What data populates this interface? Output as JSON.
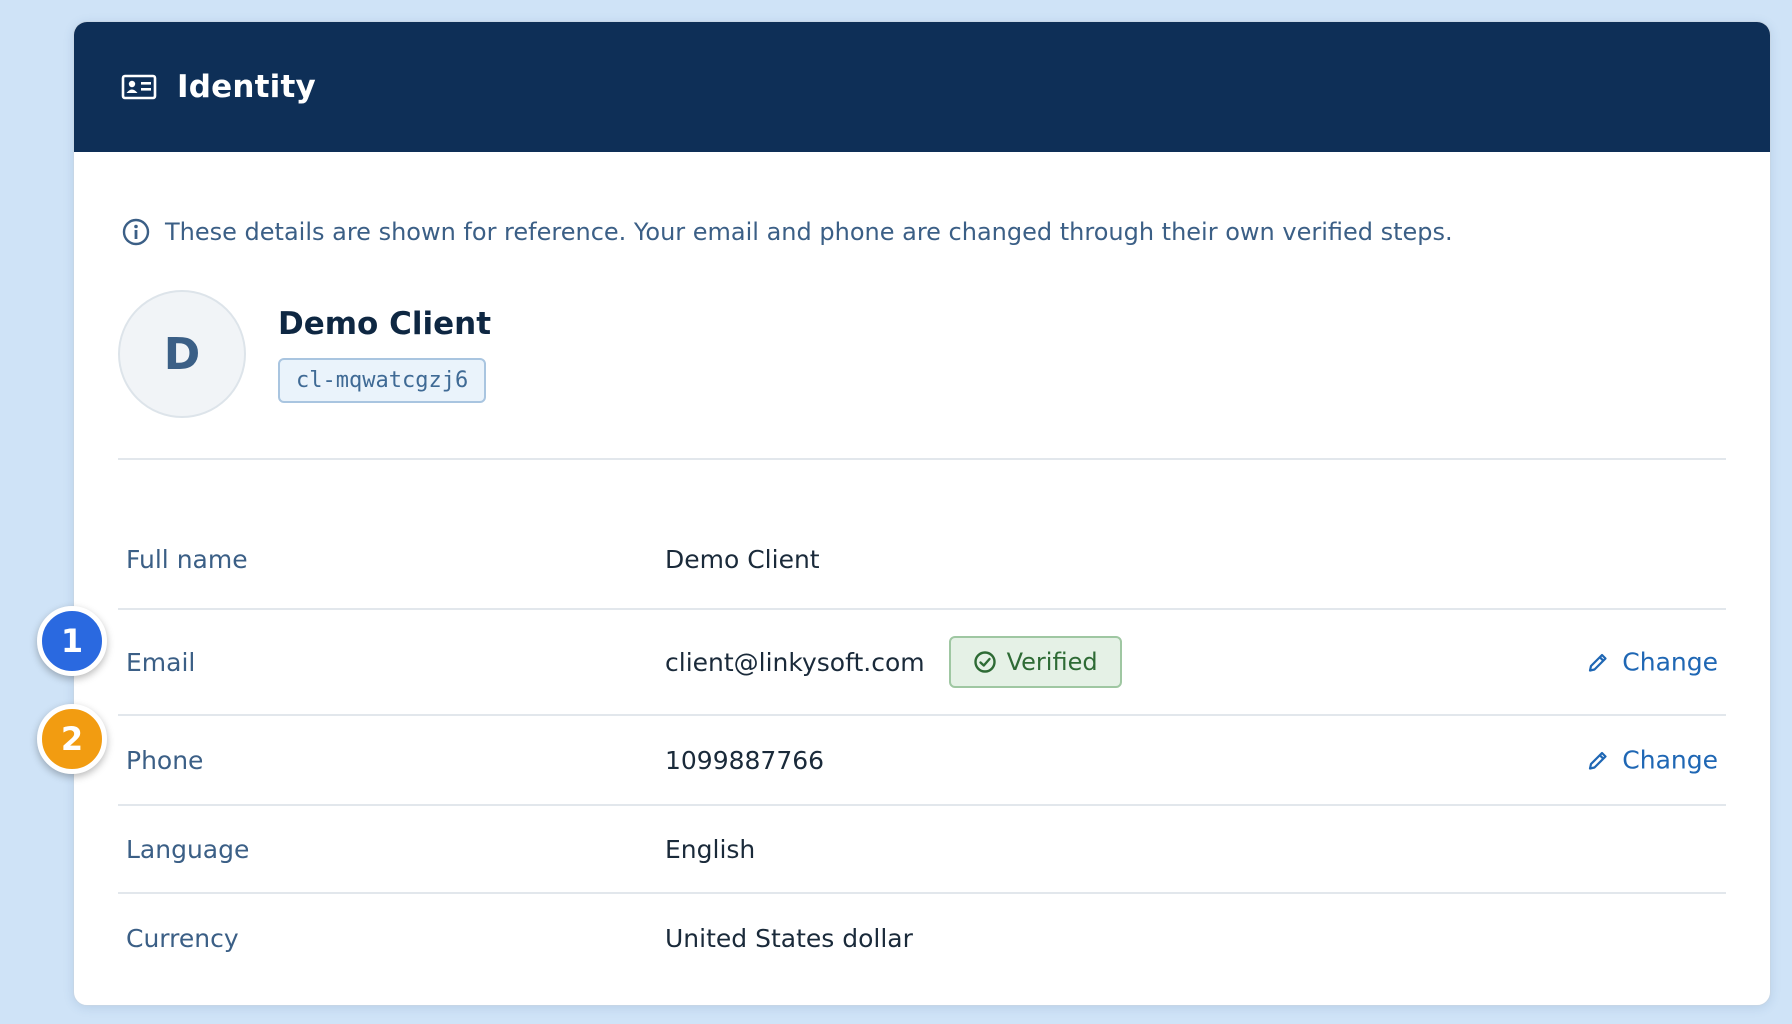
{
  "header": {
    "title": "Identity",
    "icon": "id-card-icon"
  },
  "info": {
    "icon": "info-icon",
    "text": "These details are shown for reference. Your email and phone are changed through their own verified steps."
  },
  "profile": {
    "avatar_letter": "D",
    "name": "Demo Client",
    "client_id": "cl-mqwatcgzj6"
  },
  "fields": [
    {
      "label": "Full name",
      "value": "Demo Client"
    },
    {
      "label": "Email",
      "value": "client@linkysoft.com",
      "badge": "Verified",
      "action": "Change"
    },
    {
      "label": "Phone",
      "value": "1099887766",
      "action": "Change"
    },
    {
      "label": "Language",
      "value": "English"
    },
    {
      "label": "Currency",
      "value": "United States dollar"
    }
  ],
  "markers": [
    "1",
    "2"
  ],
  "colors": {
    "header_bg": "#0e2f57",
    "accent_link": "#1f67b4",
    "verified": "#2e6b35",
    "marker_1": "#2a69e0",
    "marker_2": "#f29c11"
  }
}
